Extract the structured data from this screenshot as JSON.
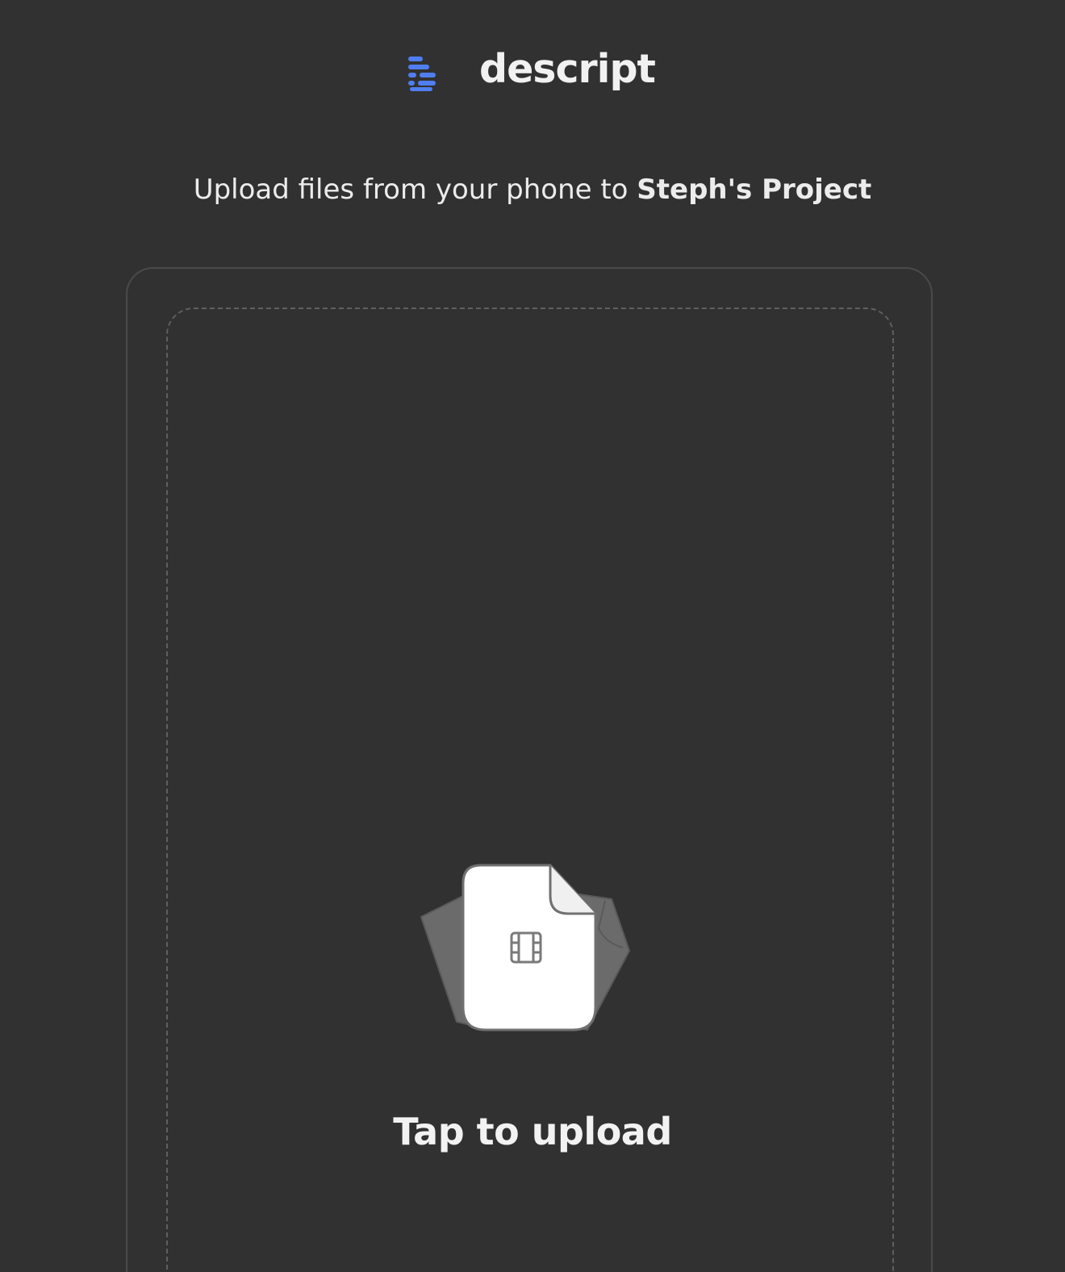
{
  "brand": {
    "name": "descript",
    "logo_icon": "descript-logo-icon",
    "accent_color": "#4f7ef0"
  },
  "subtitle": {
    "prefix": "Upload files from your phone to ",
    "project_name": "Steph's Project"
  },
  "upload": {
    "icon": "video-file-stack-icon",
    "label": "Tap to upload"
  }
}
